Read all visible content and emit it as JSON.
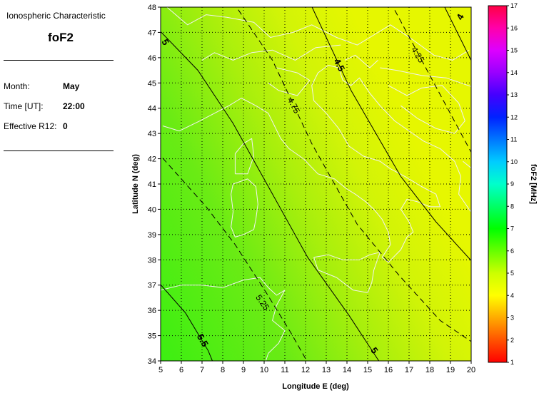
{
  "sidebar": {
    "caption": "Ionospheric Characteristic",
    "parameter": "foF2",
    "rows": [
      {
        "label": "Month:",
        "value": "May"
      },
      {
        "label": "Time [UT]:",
        "value": "22:00"
      },
      {
        "label": "Effective R12:",
        "value": "0"
      }
    ]
  },
  "map": {
    "x_label": "Longitude E (deg)",
    "y_label": "Latitude N (deg)",
    "x_ticks": [
      "5",
      "6",
      "7",
      "8",
      "9",
      "10",
      "11",
      "12",
      "13",
      "14",
      "15",
      "16",
      "17",
      "18",
      "19",
      "20"
    ],
    "y_ticks": [
      "34",
      "35",
      "36",
      "37",
      "38",
      "39",
      "40",
      "41",
      "42",
      "43",
      "44",
      "45",
      "46",
      "47",
      "48"
    ],
    "xlim": [
      5,
      20
    ],
    "ylim": [
      34,
      48
    ],
    "grid": "dotted",
    "contours": [
      {
        "label": "4",
        "style": "solid",
        "points": [
          [
            18.6,
            48.2
          ],
          [
            20.3,
            45.4
          ]
        ]
      },
      {
        "label": "4.25",
        "style": "dashed",
        "points": [
          [
            16.1,
            48.2
          ],
          [
            20.3,
            41.8
          ]
        ]
      },
      {
        "label": "4.5",
        "style": "solid",
        "points": [
          [
            12.2,
            48.2
          ],
          [
            14.2,
            44.7
          ],
          [
            16.6,
            41.3
          ],
          [
            18.3,
            39.5
          ],
          [
            20.3,
            37.7
          ]
        ]
      },
      {
        "label": "4.75",
        "style": "dashed",
        "points": [
          [
            8.5,
            48.2
          ],
          [
            10.4,
            45.9
          ],
          [
            12.3,
            42.6
          ],
          [
            14.5,
            39.4
          ],
          [
            16.5,
            37.4
          ],
          [
            18.5,
            35.6
          ],
          [
            20.3,
            34.6
          ]
        ]
      },
      {
        "label": "5",
        "style": "solid",
        "points": [
          [
            4.8,
            47.2
          ],
          [
            6.8,
            45.5
          ],
          [
            8.5,
            43.4
          ],
          [
            10.2,
            40.9
          ],
          [
            12.1,
            38.1
          ],
          [
            14.1,
            35.8
          ],
          [
            15.7,
            33.8
          ]
        ]
      },
      {
        "label": "5.25",
        "style": "dashed",
        "points": [
          [
            4.8,
            42.3
          ],
          [
            7.2,
            40.1
          ],
          [
            8.6,
            38.6
          ],
          [
            10.1,
            36.7
          ],
          [
            11.3,
            35.1
          ],
          [
            12.2,
            33.8
          ]
        ]
      },
      {
        "label": "5.5",
        "style": "solid",
        "points": [
          [
            4.8,
            37.2
          ],
          [
            6.2,
            35.9
          ],
          [
            7.3,
            34.4
          ],
          [
            7.6,
            33.8
          ]
        ]
      }
    ],
    "contour_labels": [
      {
        "text": "4",
        "lon": 19.5,
        "lat": 47.6,
        "bold": true,
        "rot": -62
      },
      {
        "text": "4.25",
        "lon": 17.4,
        "lat": 46.1,
        "bold": false,
        "rot": 58
      },
      {
        "text": "4.5",
        "lon": 13.6,
        "lat": 45.7,
        "bold": true,
        "rot": 62
      },
      {
        "text": "4.75",
        "lon": 11.4,
        "lat": 44.1,
        "bold": false,
        "rot": 62
      },
      {
        "text": "5",
        "lon": 5.2,
        "lat": 46.6,
        "bold": true,
        "rot": 60
      },
      {
        "text": "5",
        "lon": 15.3,
        "lat": 34.4,
        "bold": true,
        "rot": 55
      },
      {
        "text": "5.25",
        "lon": 9.9,
        "lat": 36.3,
        "bold": false,
        "rot": 55
      },
      {
        "text": "5.5",
        "lon": 7.0,
        "lat": 34.8,
        "bold": true,
        "rot": 60
      }
    ],
    "coastlines": [
      [
        [
          5.1,
          43.3
        ],
        [
          5.9,
          43.1
        ],
        [
          6.9,
          43.5
        ],
        [
          7.6,
          43.8
        ],
        [
          8.3,
          44.1
        ],
        [
          8.9,
          44.4
        ],
        [
          9.6,
          44.1
        ],
        [
          10.2,
          43.8
        ],
        [
          10.5,
          43.3
        ],
        [
          10.8,
          42.8
        ],
        [
          11.2,
          42.4
        ],
        [
          11.9,
          42.0
        ],
        [
          12.6,
          41.4
        ],
        [
          13.4,
          41.2
        ],
        [
          14.0,
          40.8
        ],
        [
          14.4,
          40.6
        ],
        [
          14.9,
          40.3
        ],
        [
          15.3,
          40.0
        ],
        [
          15.7,
          39.6
        ],
        [
          16.0,
          39.1
        ],
        [
          16.1,
          38.6
        ],
        [
          15.7,
          38.1
        ],
        [
          16.0,
          37.9
        ],
        [
          16.6,
          38.4
        ],
        [
          16.9,
          38.9
        ],
        [
          17.2,
          39.1
        ],
        [
          17.0,
          39.5
        ],
        [
          16.6,
          40.0
        ],
        [
          16.9,
          40.4
        ],
        [
          17.4,
          40.3
        ],
        [
          18.0,
          40.1
        ],
        [
          18.5,
          40.1
        ],
        [
          18.3,
          40.6
        ],
        [
          17.6,
          40.9
        ],
        [
          16.8,
          41.3
        ],
        [
          16.1,
          41.6
        ],
        [
          15.6,
          41.9
        ],
        [
          14.8,
          42.1
        ],
        [
          14.1,
          42.5
        ],
        [
          13.6,
          43.2
        ],
        [
          13.0,
          43.8
        ],
        [
          12.4,
          44.3
        ],
        [
          12.3,
          44.9
        ],
        [
          12.6,
          45.4
        ],
        [
          13.1,
          45.7
        ],
        [
          13.6,
          45.6
        ],
        [
          13.8,
          45.1
        ],
        [
          14.2,
          44.9
        ],
        [
          14.6,
          45.2
        ],
        [
          15.1,
          44.6
        ],
        [
          15.6,
          44.1
        ],
        [
          16.3,
          43.5
        ],
        [
          17.0,
          43.1
        ],
        [
          17.7,
          42.7
        ],
        [
          18.5,
          42.4
        ],
        [
          19.2,
          41.9
        ],
        [
          19.5,
          41.3
        ],
        [
          19.4,
          40.6
        ],
        [
          19.9,
          40.0
        ],
        [
          20.2,
          39.7
        ]
      ],
      [
        [
          8.5,
          41.0
        ],
        [
          9.2,
          41.2
        ],
        [
          9.6,
          40.9
        ],
        [
          9.7,
          40.2
        ],
        [
          9.6,
          39.6
        ],
        [
          9.5,
          39.2
        ],
        [
          9.0,
          39.0
        ],
        [
          8.6,
          38.9
        ],
        [
          8.4,
          39.3
        ],
        [
          8.5,
          39.9
        ],
        [
          8.4,
          40.6
        ],
        [
          8.5,
          41.0
        ]
      ],
      [
        [
          8.6,
          41.4
        ],
        [
          9.2,
          41.4
        ],
        [
          9.5,
          42.1
        ],
        [
          9.4,
          42.8
        ],
        [
          9.0,
          42.6
        ],
        [
          8.6,
          42.2
        ],
        [
          8.6,
          41.4
        ]
      ],
      [
        [
          12.4,
          38.1
        ],
        [
          13.1,
          38.2
        ],
        [
          13.8,
          38.0
        ],
        [
          14.6,
          38.0
        ],
        [
          15.1,
          38.2
        ],
        [
          15.6,
          38.3
        ],
        [
          15.3,
          37.6
        ],
        [
          15.2,
          37.1
        ],
        [
          15.0,
          36.7
        ],
        [
          14.3,
          36.8
        ],
        [
          13.5,
          37.3
        ],
        [
          12.6,
          37.6
        ],
        [
          12.4,
          38.1
        ]
      ],
      [
        [
          5.0,
          36.8
        ],
        [
          6.0,
          37.0
        ],
        [
          7.0,
          37.0
        ],
        [
          8.0,
          36.9
        ],
        [
          9.0,
          37.2
        ],
        [
          9.8,
          37.3
        ],
        [
          10.2,
          36.9
        ],
        [
          10.6,
          36.6
        ],
        [
          11.0,
          36.8
        ],
        [
          10.6,
          36.2
        ],
        [
          10.4,
          35.6
        ],
        [
          11.0,
          35.2
        ],
        [
          10.7,
          34.7
        ],
        [
          10.2,
          34.3
        ],
        [
          10.0,
          33.8
        ]
      ],
      [
        [
          5.3,
          48.0
        ],
        [
          6.3,
          47.3
        ],
        [
          7.2,
          47.7
        ],
        [
          8.2,
          47.6
        ],
        [
          9.5,
          47.4
        ],
        [
          10.3,
          46.8
        ],
        [
          11.4,
          47.0
        ],
        [
          12.3,
          47.3
        ],
        [
          13.5,
          46.8
        ],
        [
          14.5,
          46.5
        ],
        [
          15.3,
          46.9
        ],
        [
          16.1,
          47.3
        ],
        [
          17.2,
          46.7
        ],
        [
          18.2,
          46.1
        ],
        [
          19.1,
          45.9
        ],
        [
          19.9,
          46.3
        ]
      ],
      [
        [
          7.0,
          45.9
        ],
        [
          7.6,
          46.2
        ],
        [
          8.5,
          45.9
        ],
        [
          9.4,
          46.2
        ],
        [
          10.4,
          46.3
        ],
        [
          11.5,
          45.9
        ],
        [
          12.5,
          46.4
        ],
        [
          13.7,
          46.5
        ]
      ],
      [
        [
          15.6,
          45.6
        ],
        [
          16.4,
          45.5
        ],
        [
          17.6,
          45.3
        ],
        [
          18.8,
          45.2
        ],
        [
          19.5,
          45.0
        ],
        [
          20.2,
          44.8
        ]
      ],
      [
        [
          16.0,
          44.9
        ],
        [
          16.9,
          44.5
        ],
        [
          17.6,
          44.8
        ],
        [
          18.6,
          44.9
        ],
        [
          19.4,
          44.2
        ],
        [
          19.7,
          43.5
        ],
        [
          19.2,
          43.0
        ],
        [
          18.3,
          43.2
        ],
        [
          17.4,
          43.6
        ],
        [
          16.6,
          44.1
        ]
      ],
      [
        [
          19.6,
          41.9
        ],
        [
          20.2,
          41.5
        ]
      ],
      [
        [
          13.9,
          45.9
        ],
        [
          14.4,
          46.1
        ],
        [
          15.1,
          45.6
        ],
        [
          15.5,
          45.9
        ]
      ],
      [
        [
          10.6,
          45.6
        ],
        [
          11.6,
          45.4
        ],
        [
          12.2,
          45.1
        ],
        [
          11.6,
          44.5
        ],
        [
          10.7,
          44.7
        ],
        [
          10.2,
          45.0
        ]
      ]
    ],
    "colorbar": {
      "title": "foF2 [MHz]",
      "ticks": [
        "1",
        "2",
        "3",
        "4",
        "5",
        "6",
        "7",
        "8",
        "9",
        "10",
        "11",
        "12",
        "13",
        "14",
        "15",
        "16",
        "17"
      ],
      "min": 1,
      "max": 17
    },
    "colors": {
      "coastline": "#f2f2f2",
      "contour": "#000000"
    }
  }
}
